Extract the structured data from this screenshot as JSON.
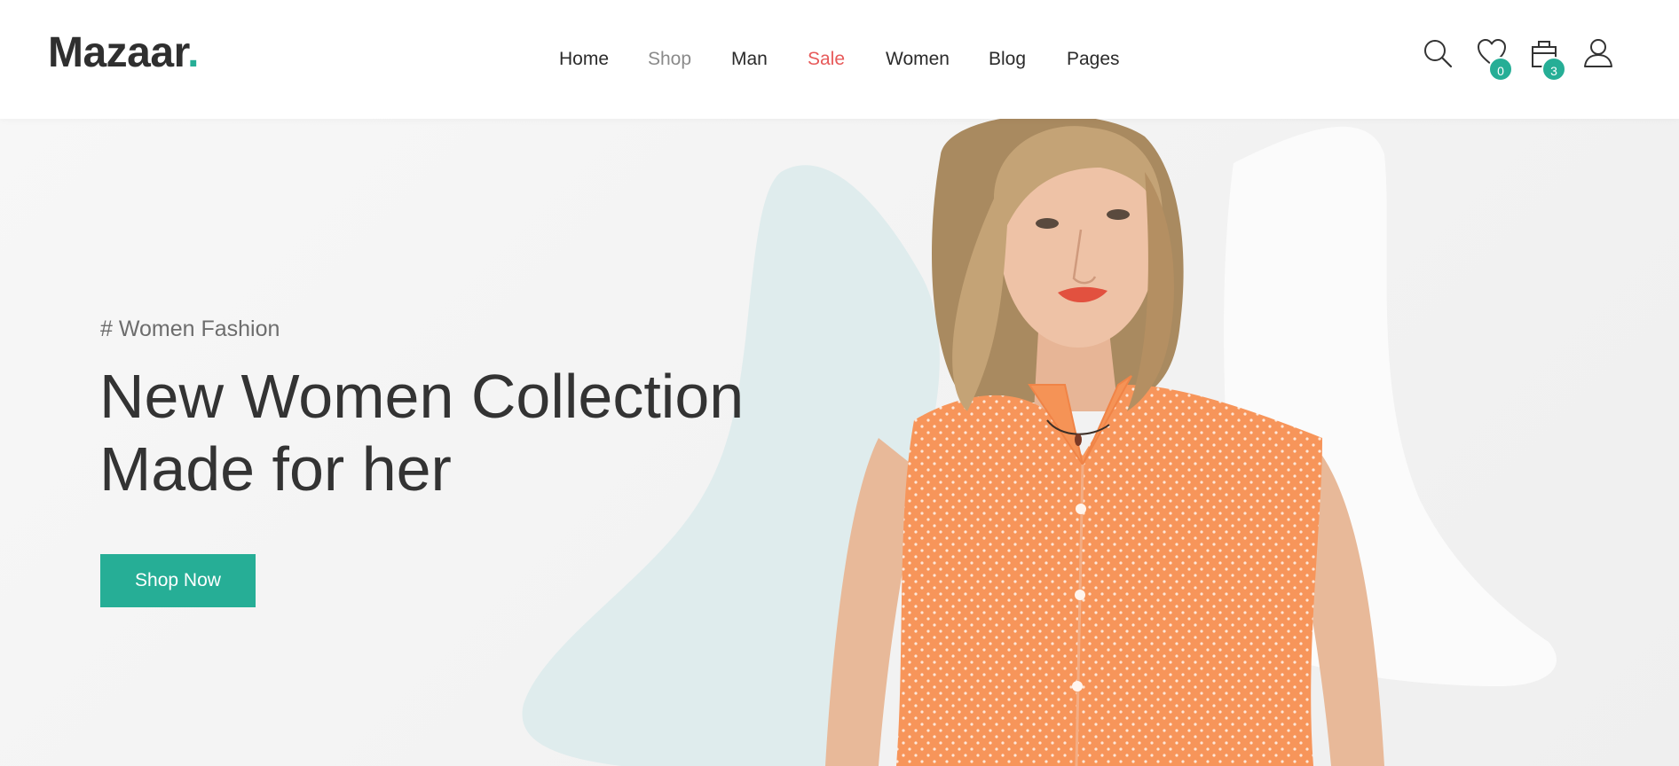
{
  "brand": {
    "name": "Mazaar",
    "dot": "."
  },
  "nav": {
    "items": [
      {
        "label": "Home"
      },
      {
        "label": "Shop"
      },
      {
        "label": "Man"
      },
      {
        "label": "Sale"
      },
      {
        "label": "Women"
      },
      {
        "label": "Blog"
      },
      {
        "label": "Pages"
      }
    ]
  },
  "tools": {
    "search_icon": "search-icon",
    "wishlist_icon": "heart-icon",
    "wishlist_count": "0",
    "cart_icon": "shopping-bag-icon",
    "cart_count": "3",
    "account_icon": "user-icon"
  },
  "hero": {
    "kicker": "# Women Fashion",
    "headline_line1": "New Women Collection",
    "headline_line2": "Made for her",
    "cta_label": "Shop Now"
  },
  "colors": {
    "accent": "#26ae96",
    "sale": "#e75a5a",
    "text": "#333333",
    "muted": "#8a8a8a",
    "hero_bg": "#f3f3f3",
    "blob": "#dfeced",
    "shirt": "#f7955a"
  }
}
